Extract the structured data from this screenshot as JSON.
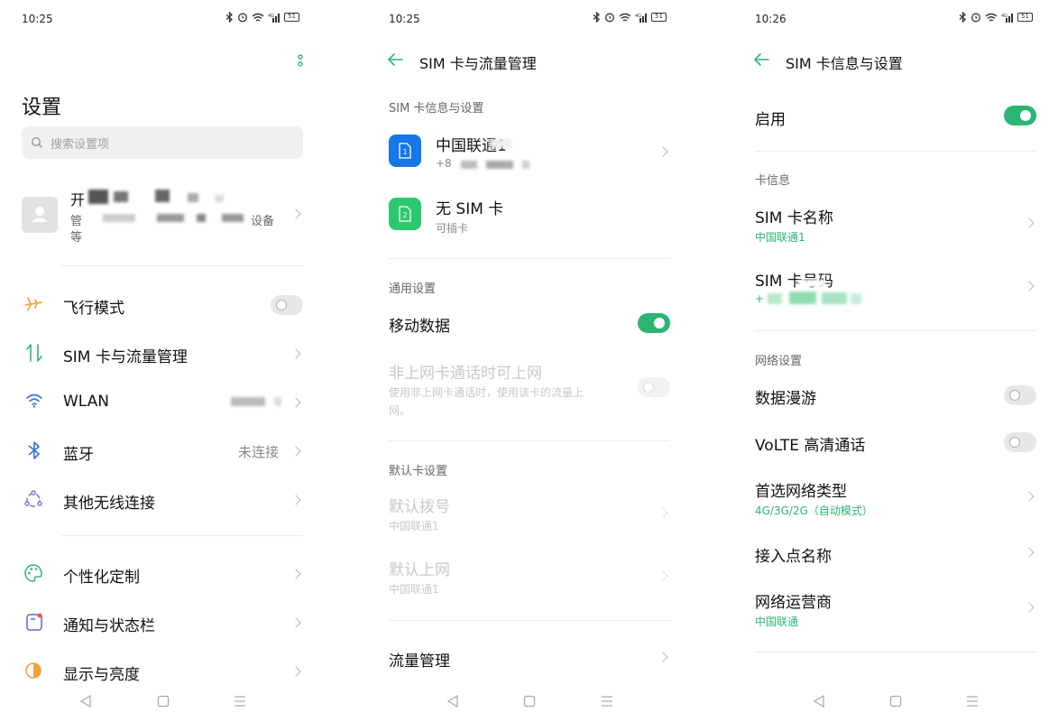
{
  "panel1": {
    "time": "10:25",
    "battery": "51",
    "title": "设置",
    "search_placeholder": "搜索设置项",
    "account": {
      "name_visible": "开",
      "desc_prefix": "管",
      "desc_suffix": "设备",
      "desc_line2": "等"
    },
    "items": [
      {
        "icon": "airplane-icon",
        "label": "飞行模式",
        "control": "toggle-off"
      },
      {
        "icon": "sim-data-icon",
        "label": "SIM 卡与流量管理",
        "control": "chevron"
      },
      {
        "icon": "wifi-icon",
        "label": "WLAN",
        "control": "chevron"
      },
      {
        "icon": "bluetooth-icon",
        "label": "蓝牙",
        "value": "未连接",
        "control": "chevron"
      },
      {
        "icon": "wireless-other-icon",
        "label": "其他无线连接",
        "control": "chevron"
      },
      {
        "icon": "palette-icon",
        "label": "个性化定制",
        "control": "chevron"
      },
      {
        "icon": "notification-icon",
        "label": "通知与状态栏",
        "control": "chevron"
      },
      {
        "icon": "brightness-icon",
        "label": "显示与亮度",
        "control": "chevron"
      }
    ]
  },
  "panel2": {
    "time": "10:25",
    "battery": "51",
    "title": "SIM 卡与流量管理",
    "section_sim": "SIM 卡信息与设置",
    "sim1": {
      "badge": "1",
      "name": "中国联通1",
      "number_prefix": "+8"
    },
    "sim2": {
      "badge": "2",
      "name": "无 SIM 卡",
      "desc": "可插卡"
    },
    "section_general": "通用设置",
    "mobile_data": "移动数据",
    "non_data_call": {
      "title": "非上网卡通话时可上网",
      "desc_line1": "使用非上网卡通话时，使用该卡的流量上",
      "desc_line2": "网。"
    },
    "section_default": "默认卡设置",
    "default_dial": {
      "title": "默认拨号",
      "value": "中国联通1"
    },
    "default_data": {
      "title": "默认上网",
      "value": "中国联通1"
    },
    "data_management": "流量管理"
  },
  "panel3": {
    "time": "10:26",
    "battery": "51",
    "title": "SIM 卡信息与设置",
    "enable": "启用",
    "section_card": "卡信息",
    "card_name": {
      "title": "SIM 卡名称",
      "value": "中国联通1"
    },
    "card_number": {
      "title": "SIM 卡号码",
      "value_prefix": "+"
    },
    "section_network": "网络设置",
    "roaming": "数据漫游",
    "volte": "VoLTE 高清通话",
    "preferred_network": {
      "title": "首选网络类型",
      "value": "4G/3G/2G（自动模式）"
    },
    "apn": "接入点名称",
    "carrier": {
      "title": "网络运营商",
      "value": "中国联通"
    }
  },
  "colors": {
    "accent": "#2bb673",
    "sim_blue": "#1677e8",
    "sim_green": "#2bc96e"
  }
}
